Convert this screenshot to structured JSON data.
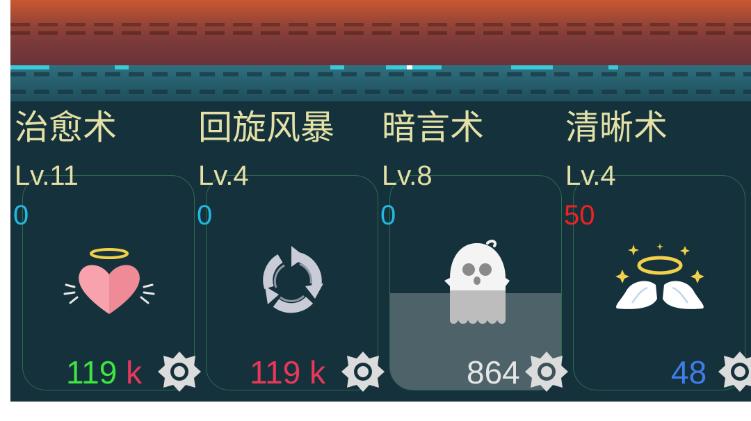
{
  "colors": {
    "name_text": "#e5e1a6",
    "cost_zero": "#22b8e0",
    "cost_nonzero": "#ee2222",
    "green_value": "#3fe53f",
    "red_value": "#e8385a",
    "white_value": "#e6e6e6",
    "blue_value": "#3f7ee8"
  },
  "skills": [
    {
      "name": "治愈术",
      "level": "Lv.11",
      "cost": "0",
      "icon": "heart-halo-icon",
      "value": "119",
      "unit": "k",
      "fill_level": 0
    },
    {
      "name": "回旋风暴",
      "level": "Lv.4",
      "cost": "0",
      "icon": "whirlwind-arrows-icon",
      "value": "119",
      "unit": "k",
      "fill_level": 0
    },
    {
      "name": "暗言术",
      "level": "Lv.8",
      "cost": "0",
      "icon": "ghost-skull-icon",
      "value": "864",
      "unit": "",
      "fill_level": 0.45
    },
    {
      "name": "清晰术",
      "level": "Lv.4",
      "cost": "50",
      "icon": "winged-halo-icon",
      "value": "48",
      "unit": "",
      "fill_level": 0
    }
  ]
}
